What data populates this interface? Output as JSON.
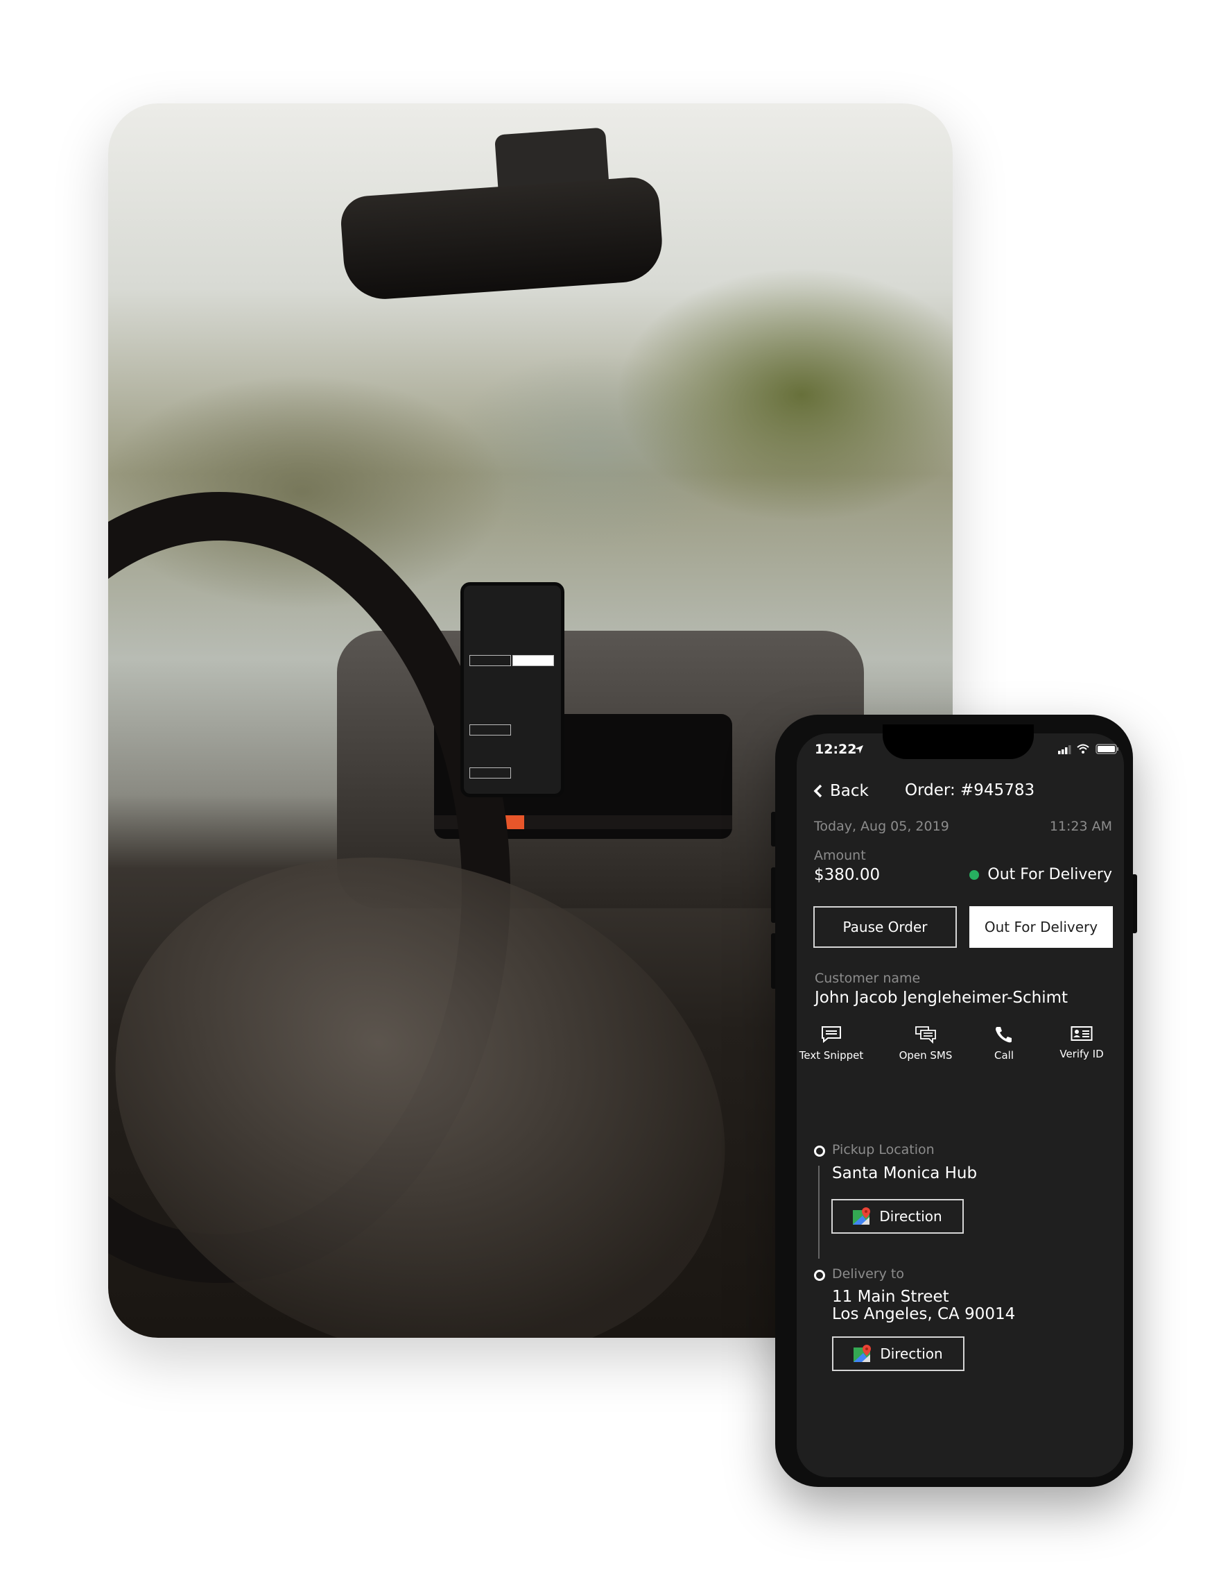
{
  "status_bar": {
    "time": "12:22",
    "location_icon": "location-arrow-icon",
    "signal_icon": "signal-icon",
    "wifi_icon": "wifi-icon",
    "battery_icon": "battery-icon"
  },
  "header": {
    "back_label": "Back",
    "title": "Order: #945783"
  },
  "order": {
    "date": "Today, Aug 05, 2019",
    "time": "11:23 AM",
    "amount_label": "Amount",
    "amount": "$380.00",
    "status": "Out For Delivery",
    "status_color": "#27ae60"
  },
  "buttons": {
    "pause": "Pause Order",
    "out_for_delivery": "Out For Delivery"
  },
  "customer": {
    "label": "Customer name",
    "name": "John Jacob Jengleheimer-Schimt"
  },
  "actions": [
    {
      "label": "Text Snippet",
      "icon": "message-icon"
    },
    {
      "label": "Open SMS",
      "icon": "chat-icon"
    },
    {
      "label": "Call",
      "icon": "phone-icon"
    },
    {
      "label": "Verify ID",
      "icon": "id-card-icon"
    }
  ],
  "pickup": {
    "label": "Pickup Location",
    "name": "Santa Monica Hub",
    "direction_label": "Direction"
  },
  "delivery": {
    "label": "Delivery to",
    "line1": "11 Main Street",
    "line2": "Los Angeles, CA 90014",
    "direction_label": "Direction"
  }
}
